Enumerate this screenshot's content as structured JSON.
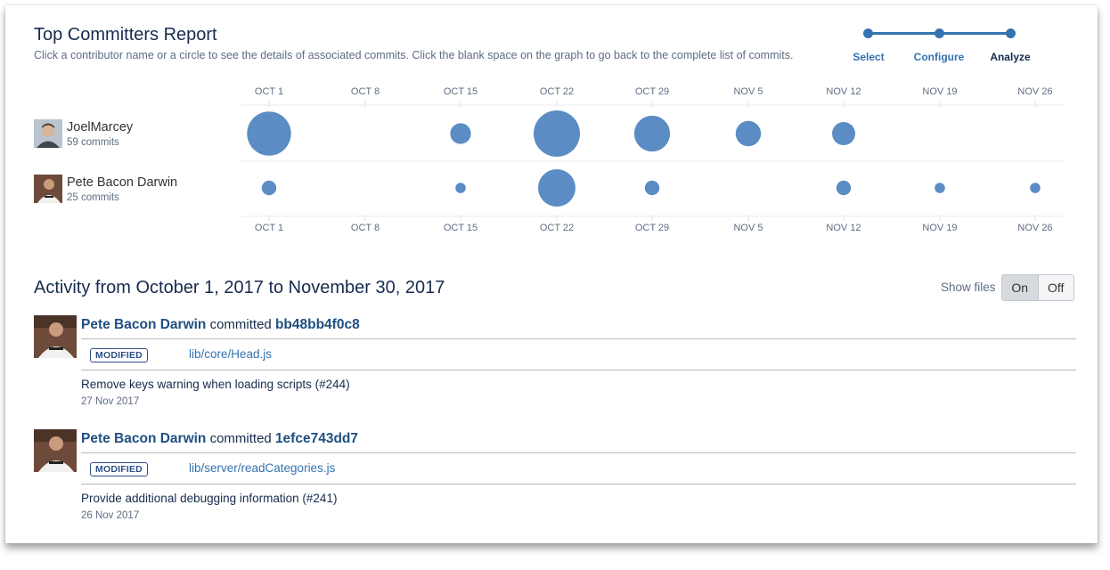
{
  "report": {
    "title": "Top Committers Report",
    "description": "Click a contributor name or a circle to see the details of associated commits. Click the blank space on the graph to go back to the complete list of commits."
  },
  "wizard": {
    "steps": [
      {
        "label": "Select",
        "state": "done"
      },
      {
        "label": "Configure",
        "state": "done"
      },
      {
        "label": "Analyze",
        "state": "current"
      }
    ],
    "accent": "#3572b0"
  },
  "chart_data": {
    "type": "scatter",
    "categories": [
      "OCT 1",
      "OCT 8",
      "OCT 15",
      "OCT 22",
      "OCT 29",
      "NOV 5",
      "NOV 12",
      "NOV 19",
      "NOV 26"
    ],
    "color": "#5b8cc4",
    "series": [
      {
        "name": "JoelMarcey",
        "label": "59 commits",
        "values": [
          18,
          0,
          4,
          20,
          12,
          6,
          5,
          0,
          0
        ]
      },
      {
        "name": "Pete Bacon Darwin",
        "label": "25 commits",
        "values": [
          2,
          0,
          1,
          13,
          2,
          0,
          2,
          1,
          1
        ]
      }
    ]
  },
  "committers": [
    {
      "name": "JoelMarcey",
      "count": "59 commits",
      "avatar_icon": "user-photo-icon"
    },
    {
      "name": "Pete Bacon Darwin",
      "count": "25 commits",
      "avatar_icon": "user-photo-icon"
    }
  ],
  "activity": {
    "title": "Activity from October 1, 2017 to November 30, 2017",
    "show_files_label": "Show files",
    "toggle_on": "On",
    "toggle_off": "Off",
    "commits": [
      {
        "author": "Pete Bacon Darwin",
        "verb": "committed",
        "hash": "bb48bb4f0c8",
        "badge": "MODIFIED",
        "file": "lib/core/Head.js",
        "message": "Remove keys warning when loading scripts (#244)",
        "date": "27 Nov 2017"
      },
      {
        "author": "Pete Bacon Darwin",
        "verb": "committed",
        "hash": "1efce743dd7",
        "badge": "MODIFIED",
        "file": "lib/server/readCategories.js",
        "message": "Provide additional debugging information (#241)",
        "date": "26 Nov 2017"
      }
    ]
  }
}
